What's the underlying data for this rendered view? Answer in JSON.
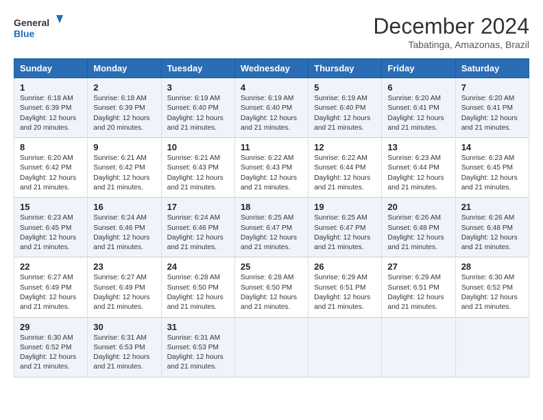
{
  "logo": {
    "line1": "General",
    "line2": "Blue"
  },
  "title": "December 2024",
  "subtitle": "Tabatinga, Amazonas, Brazil",
  "days_of_week": [
    "Sunday",
    "Monday",
    "Tuesday",
    "Wednesday",
    "Thursday",
    "Friday",
    "Saturday"
  ],
  "weeks": [
    [
      {
        "day": "1",
        "sunrise": "6:18 AM",
        "sunset": "6:39 PM",
        "daylight": "12 hours and 20 minutes."
      },
      {
        "day": "2",
        "sunrise": "6:18 AM",
        "sunset": "6:39 PM",
        "daylight": "12 hours and 20 minutes."
      },
      {
        "day": "3",
        "sunrise": "6:19 AM",
        "sunset": "6:40 PM",
        "daylight": "12 hours and 21 minutes."
      },
      {
        "day": "4",
        "sunrise": "6:19 AM",
        "sunset": "6:40 PM",
        "daylight": "12 hours and 21 minutes."
      },
      {
        "day": "5",
        "sunrise": "6:19 AM",
        "sunset": "6:40 PM",
        "daylight": "12 hours and 21 minutes."
      },
      {
        "day": "6",
        "sunrise": "6:20 AM",
        "sunset": "6:41 PM",
        "daylight": "12 hours and 21 minutes."
      },
      {
        "day": "7",
        "sunrise": "6:20 AM",
        "sunset": "6:41 PM",
        "daylight": "12 hours and 21 minutes."
      }
    ],
    [
      {
        "day": "8",
        "sunrise": "6:20 AM",
        "sunset": "6:42 PM",
        "daylight": "12 hours and 21 minutes."
      },
      {
        "day": "9",
        "sunrise": "6:21 AM",
        "sunset": "6:42 PM",
        "daylight": "12 hours and 21 minutes."
      },
      {
        "day": "10",
        "sunrise": "6:21 AM",
        "sunset": "6:43 PM",
        "daylight": "12 hours and 21 minutes."
      },
      {
        "day": "11",
        "sunrise": "6:22 AM",
        "sunset": "6:43 PM",
        "daylight": "12 hours and 21 minutes."
      },
      {
        "day": "12",
        "sunrise": "6:22 AM",
        "sunset": "6:44 PM",
        "daylight": "12 hours and 21 minutes."
      },
      {
        "day": "13",
        "sunrise": "6:23 AM",
        "sunset": "6:44 PM",
        "daylight": "12 hours and 21 minutes."
      },
      {
        "day": "14",
        "sunrise": "6:23 AM",
        "sunset": "6:45 PM",
        "daylight": "12 hours and 21 minutes."
      }
    ],
    [
      {
        "day": "15",
        "sunrise": "6:23 AM",
        "sunset": "6:45 PM",
        "daylight": "12 hours and 21 minutes."
      },
      {
        "day": "16",
        "sunrise": "6:24 AM",
        "sunset": "6:46 PM",
        "daylight": "12 hours and 21 minutes."
      },
      {
        "day": "17",
        "sunrise": "6:24 AM",
        "sunset": "6:46 PM",
        "daylight": "12 hours and 21 minutes."
      },
      {
        "day": "18",
        "sunrise": "6:25 AM",
        "sunset": "6:47 PM",
        "daylight": "12 hours and 21 minutes."
      },
      {
        "day": "19",
        "sunrise": "6:25 AM",
        "sunset": "6:47 PM",
        "daylight": "12 hours and 21 minutes."
      },
      {
        "day": "20",
        "sunrise": "6:26 AM",
        "sunset": "6:48 PM",
        "daylight": "12 hours and 21 minutes."
      },
      {
        "day": "21",
        "sunrise": "6:26 AM",
        "sunset": "6:48 PM",
        "daylight": "12 hours and 21 minutes."
      }
    ],
    [
      {
        "day": "22",
        "sunrise": "6:27 AM",
        "sunset": "6:49 PM",
        "daylight": "12 hours and 21 minutes."
      },
      {
        "day": "23",
        "sunrise": "6:27 AM",
        "sunset": "6:49 PM",
        "daylight": "12 hours and 21 minutes."
      },
      {
        "day": "24",
        "sunrise": "6:28 AM",
        "sunset": "6:50 PM",
        "daylight": "12 hours and 21 minutes."
      },
      {
        "day": "25",
        "sunrise": "6:28 AM",
        "sunset": "6:50 PM",
        "daylight": "12 hours and 21 minutes."
      },
      {
        "day": "26",
        "sunrise": "6:29 AM",
        "sunset": "6:51 PM",
        "daylight": "12 hours and 21 minutes."
      },
      {
        "day": "27",
        "sunrise": "6:29 AM",
        "sunset": "6:51 PM",
        "daylight": "12 hours and 21 minutes."
      },
      {
        "day": "28",
        "sunrise": "6:30 AM",
        "sunset": "6:52 PM",
        "daylight": "12 hours and 21 minutes."
      }
    ],
    [
      {
        "day": "29",
        "sunrise": "6:30 AM",
        "sunset": "6:52 PM",
        "daylight": "12 hours and 21 minutes."
      },
      {
        "day": "30",
        "sunrise": "6:31 AM",
        "sunset": "6:53 PM",
        "daylight": "12 hours and 21 minutes."
      },
      {
        "day": "31",
        "sunrise": "6:31 AM",
        "sunset": "6:53 PM",
        "daylight": "12 hours and 21 minutes."
      },
      null,
      null,
      null,
      null
    ]
  ]
}
